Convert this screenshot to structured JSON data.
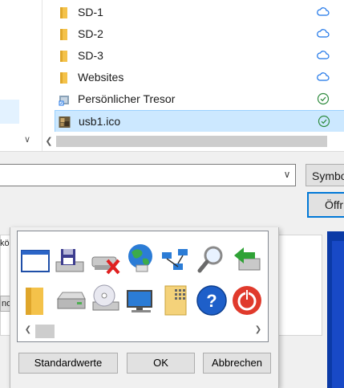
{
  "open_dialog": {
    "files": [
      {
        "name": "SD-1",
        "type": "folder",
        "status": "cloud-icon"
      },
      {
        "name": "SD-2",
        "type": "folder",
        "status": "cloud-icon"
      },
      {
        "name": "SD-3",
        "type": "folder",
        "status": "cloud-icon"
      },
      {
        "name": "Websites",
        "type": "folder",
        "status": "cloud-icon"
      },
      {
        "name": "Persönlicher Tresor",
        "type": "vault-shortcut",
        "status": "check-icon"
      },
      {
        "name": "usb1.ico",
        "type": "ico-file",
        "status": "check-icon",
        "selected": true
      }
    ],
    "filename_value": "",
    "filter_button_label": "Symbo",
    "open_button_label": "Öffr"
  },
  "behind": {
    "label1": "kö",
    "label2": "no"
  },
  "icon_dialog": {
    "icons_row1": [
      "window-icon",
      "floppy-drive-icon",
      "disconnected-drive-icon",
      "network-globe-icon",
      "network-icon",
      "magnifier-icon",
      "green-arrow-icon"
    ],
    "icons_row2": [
      "folder-icon",
      "hard-drive-icon",
      "cd-drive-icon",
      "monitor-icon",
      "document-grid-icon",
      "help-icon",
      "power-icon"
    ],
    "buttons": {
      "defaults": "Standardwerte",
      "ok": "OK",
      "cancel": "Abbrechen"
    }
  },
  "colors": {
    "selection": "#cce8ff",
    "accent": "#0078d7",
    "cloud": "#1a73e8",
    "check": "#2e8b3e"
  }
}
